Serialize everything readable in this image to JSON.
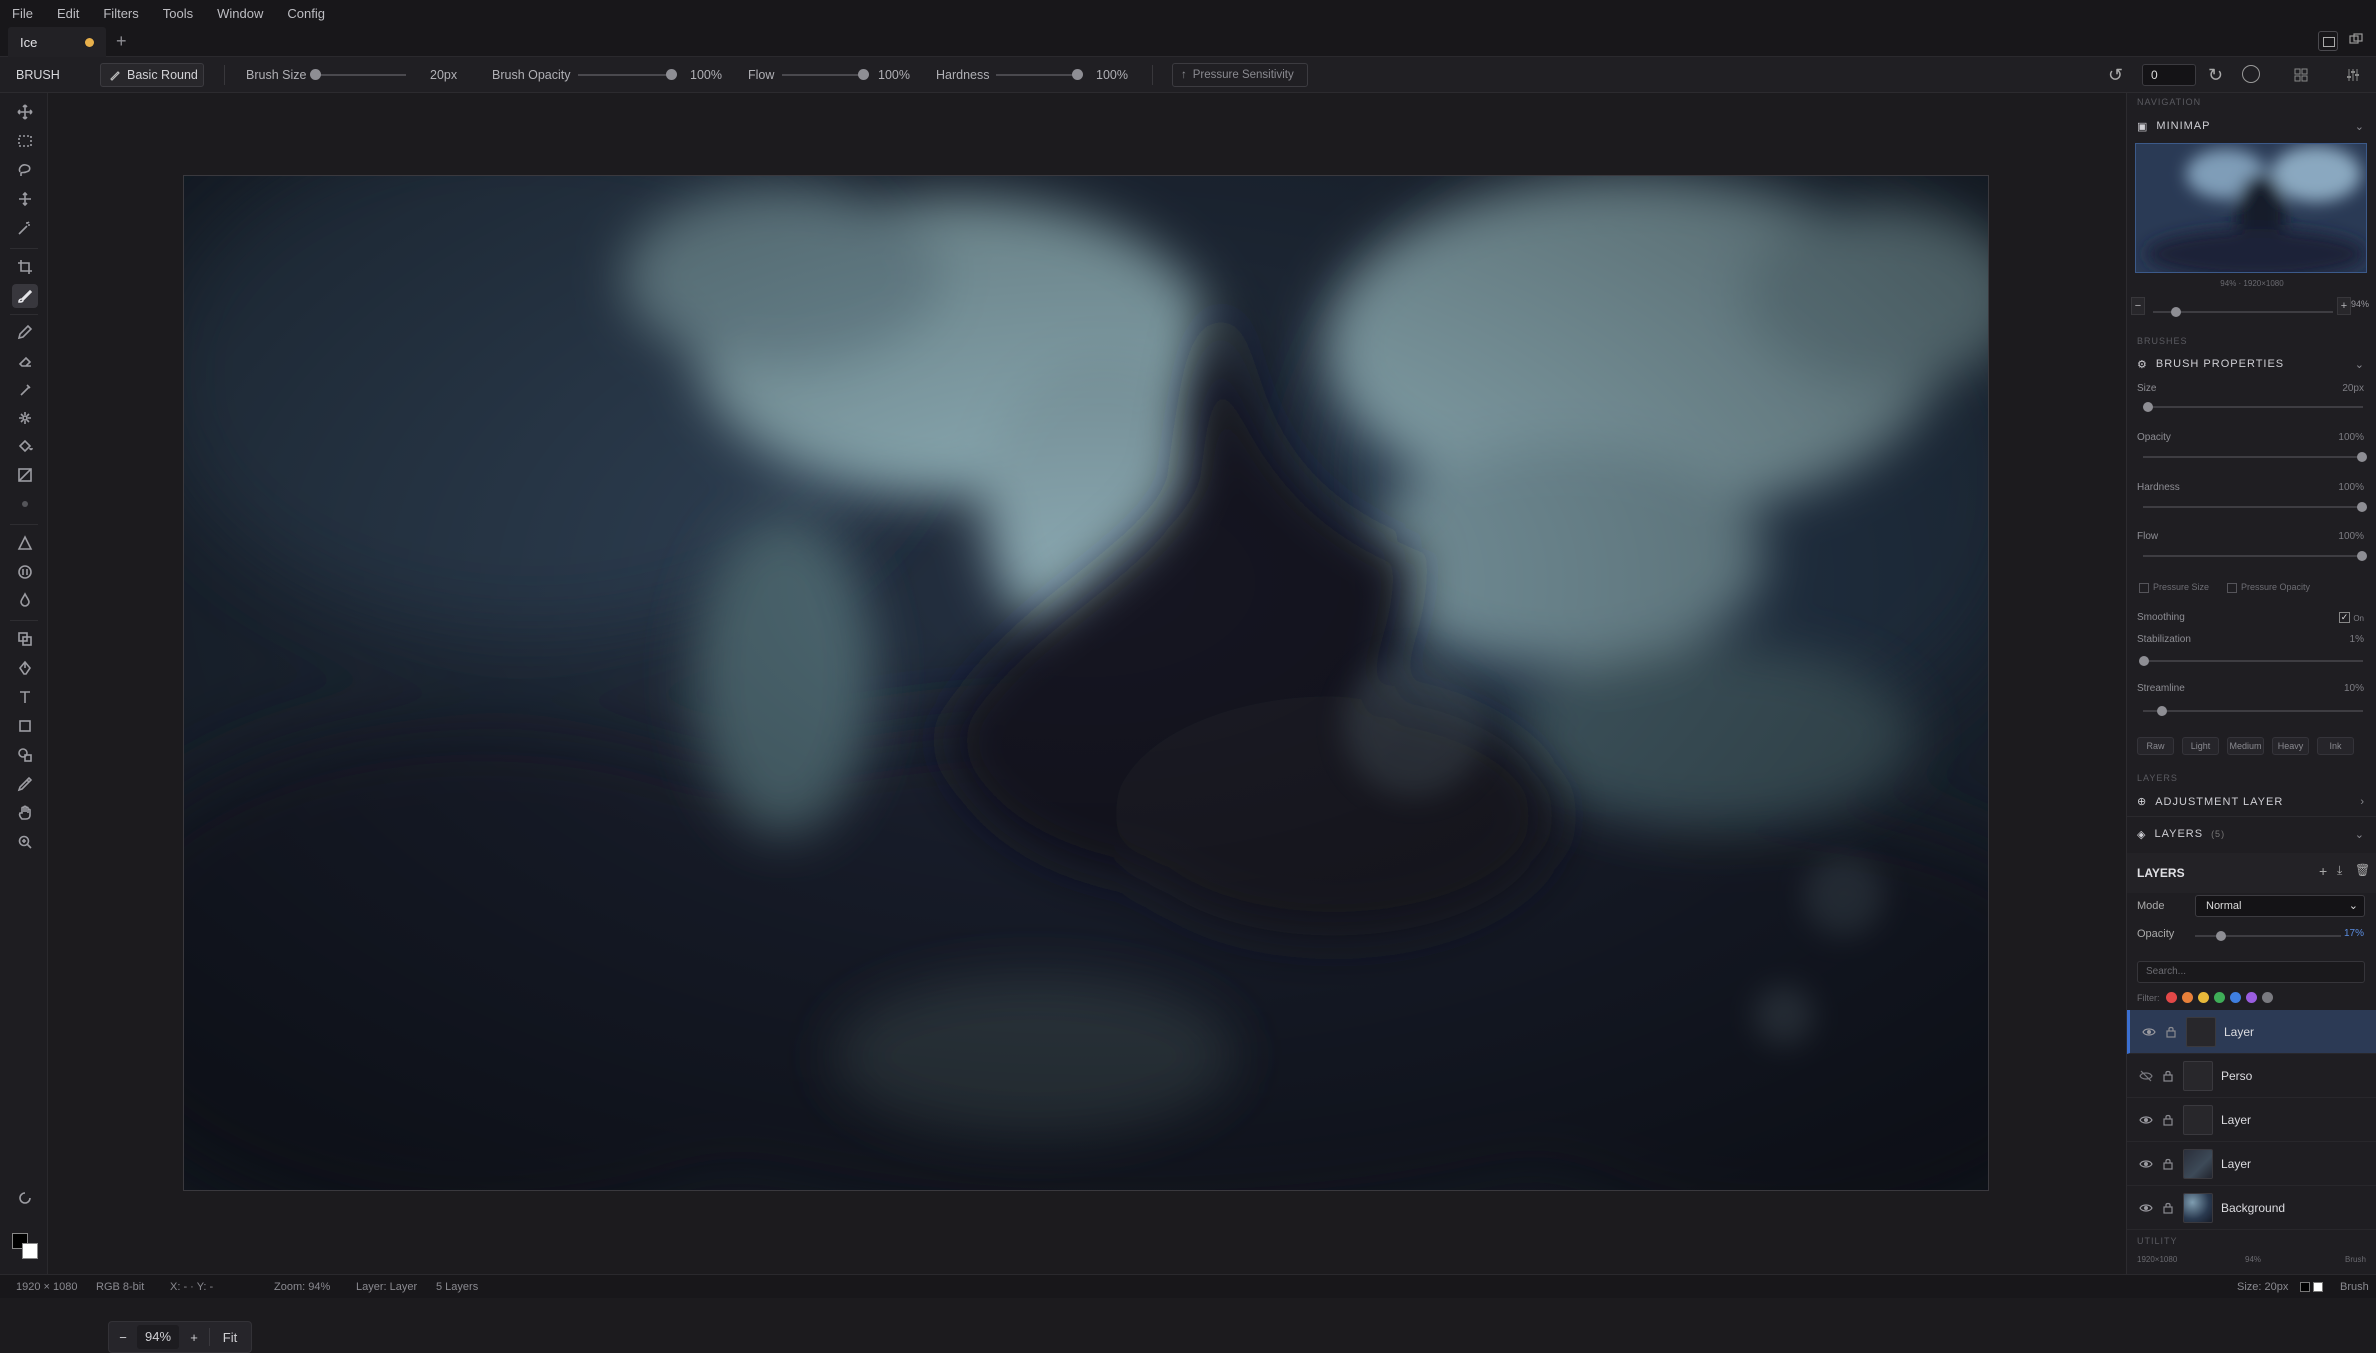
{
  "menu": [
    "File",
    "Edit",
    "Filters",
    "Tools",
    "Window",
    "Config"
  ],
  "tab": {
    "title": "Ice",
    "new_tab": "+"
  },
  "toolbar": {
    "tool_name": "BRUSH",
    "brush_preset": "Basic Round",
    "brush_size_label": "Brush Size",
    "brush_size_value": "20px",
    "brush_opacity_label": "Brush Opacity",
    "brush_opacity_value": "100%",
    "flow_label": "Flow",
    "flow_value": "100%",
    "hardness_label": "Hardness",
    "hardness_value": "100%",
    "pressure_label": "Pressure Sensitivity",
    "history_value": "0"
  },
  "zoom": {
    "minus": "−",
    "value": "94%",
    "plus": "+",
    "fit": "Fit"
  },
  "panel": {
    "navigation_section": "NAVIGATION",
    "minimap_title": "MINIMAP",
    "minimap_caption": "94% · 1920×1080",
    "minimap_zoom": "94%",
    "brushes_section": "BRUSHES",
    "brush_props_title": "BRUSH PROPERTIES",
    "size_label": "Size",
    "size_value": "20px",
    "opacity_label": "Opacity",
    "opacity_value": "100%",
    "hardness_label": "Hardness",
    "hardness_value": "100%",
    "flow_label": "Flow",
    "flow_value": "100%",
    "pressure_size": "Pressure Size",
    "pressure_opacity": "Pressure Opacity",
    "smoothing_label": "Smoothing",
    "smoothing_value": "On",
    "stabilization_label": "Stabilization",
    "stabilization_value": "1%",
    "streamline_label": "Streamline",
    "streamline_value": "10%",
    "presets": [
      "Raw",
      "Light",
      "Medium",
      "Heavy",
      "Ink"
    ],
    "layers_section": "LAYERS",
    "adjustment_title": "ADJUSTMENT LAYER",
    "layers_title": "LAYERS",
    "layers_count": "(5)",
    "layers_header": "LAYERS",
    "mode_label": "Mode",
    "mode_value": "Normal",
    "layer_opacity_label": "Opacity",
    "layer_opacity_value": "17%",
    "search_placeholder": "Search...",
    "filter_label": "Filter:",
    "filter_colors": [
      "#e34848",
      "#e8803a",
      "#e8b93a",
      "#3fae58",
      "#3f7fe0",
      "#9a5de0",
      "#7a7a80"
    ],
    "utility_section": "UTILITY",
    "utility_dims": "1920×1080",
    "utility_zoom": "94%",
    "utility_tool": "Brush"
  },
  "layers": [
    {
      "name": "Layer",
      "visible": true,
      "selected": true
    },
    {
      "name": "Perso",
      "visible": false,
      "selected": false
    },
    {
      "name": "Layer",
      "visible": true,
      "selected": false
    },
    {
      "name": "Layer",
      "visible": true,
      "selected": false
    },
    {
      "name": "Background",
      "visible": true,
      "selected": false
    }
  ],
  "status": {
    "dims": "1920 × 1080",
    "mode": "RGB 8-bit",
    "coords": "X: - · Y: -",
    "zoom": "Zoom: 94%",
    "layer": "Layer: Layer",
    "layers": "5 Layers",
    "size": "Size: 20px",
    "tool": "Brush"
  }
}
